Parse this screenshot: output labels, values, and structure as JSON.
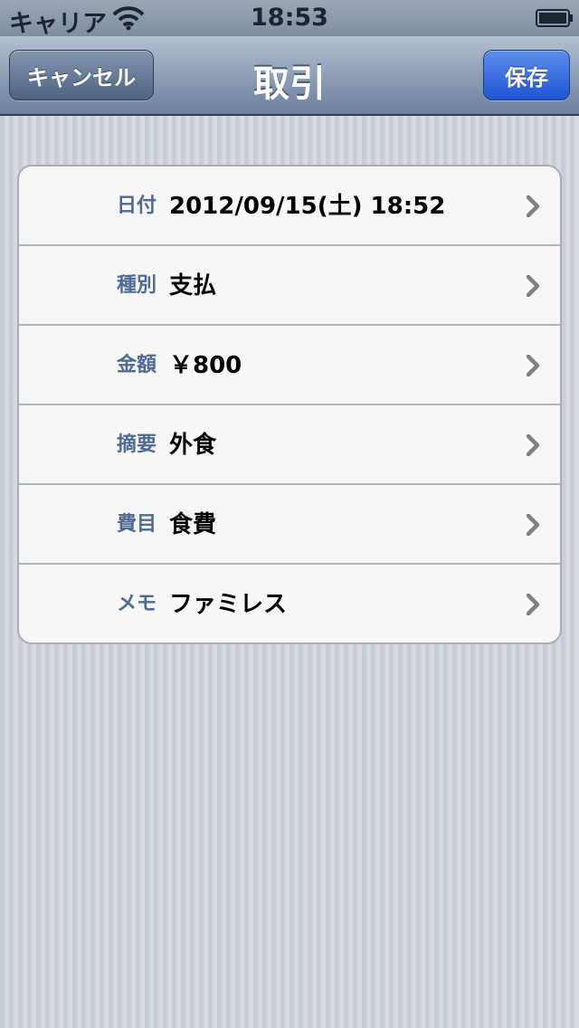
{
  "status_bar": {
    "carrier": "キャリア",
    "time": "18:53"
  },
  "nav_bar": {
    "title": "取引",
    "cancel_label": "キャンセル",
    "save_label": "保存"
  },
  "rows": [
    {
      "label": "日付",
      "value": "2012/09/15(土) 18:52"
    },
    {
      "label": "種別",
      "value": "支払"
    },
    {
      "label": "金額",
      "value": "￥800"
    },
    {
      "label": "摘要",
      "value": "外食"
    },
    {
      "label": "費目",
      "value": "食費"
    },
    {
      "label": "メモ",
      "value": "ファミレス"
    }
  ],
  "colors": {
    "label": "#4f6a92",
    "save_button": "#1f54d6",
    "nav_bar": "#8e9fb6"
  },
  "icons": {
    "status_wifi": "wifi-icon",
    "status_battery": "battery-icon",
    "row_disclosure": "chevron-right-icon"
  }
}
